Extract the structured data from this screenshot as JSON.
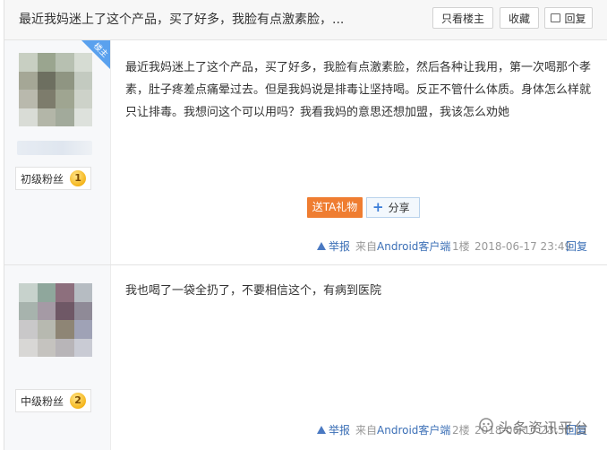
{
  "thread": {
    "title": "最近我妈迷上了这个产品，买了好多，我脸有点激素脸，...",
    "buttons": {
      "only_op": "只看楼主",
      "favorite": "收藏",
      "reply": "回复"
    }
  },
  "posts": [
    {
      "op_tag": "楼主",
      "rank": "初级粉丝",
      "level": "1",
      "content": "最近我妈迷上了这个产品，买了好多，我脸有点激素脸，然后各种让我用，第一次喝那个孝素，肚子疼差点痛晕过去。但是我妈说是排毒让坚持喝。反正不管什么体质。身体怎么样就只让排毒。我想问这个可以用吗？我看我妈的意思还想加盟，我该怎么劝她",
      "gift_label": "送TA礼物",
      "share_label": "分享",
      "report": "举报",
      "from_prefix": "来自",
      "from_source": "Android客户端",
      "floor": "1楼",
      "time": "2018-06-17 23:49",
      "reply": "回复"
    },
    {
      "rank": "中级粉丝",
      "level": "2",
      "content": "我也喝了一袋全扔了，不要相信这个，有病到医院",
      "report": "举报",
      "from_prefix": "来自",
      "from_source": "Android客户端",
      "floor": "2楼",
      "time": "2018-06-17 23:50",
      "reply": "回复"
    }
  ],
  "watermark": "头条资讯平台",
  "colors": {
    "accent": "#3b6fb6",
    "gift": "#ef7d31",
    "op_tag": "#5aa1ee"
  }
}
